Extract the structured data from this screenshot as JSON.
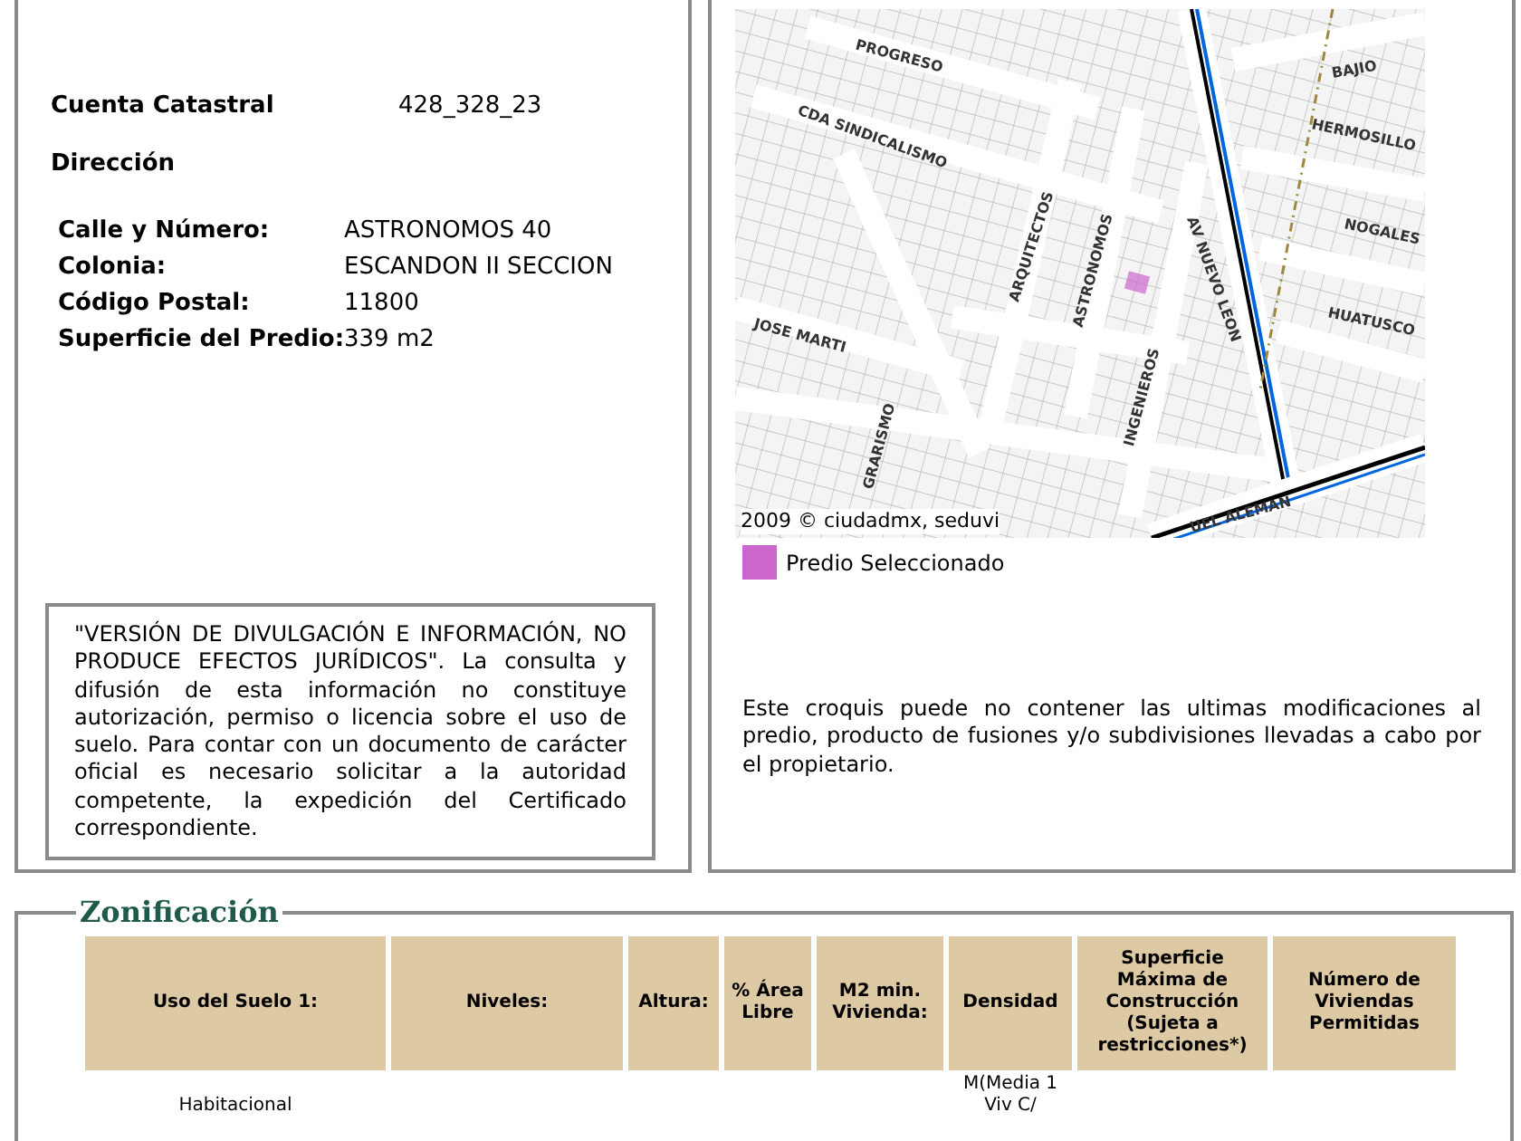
{
  "parcel": {
    "account_label": "Cuenta Catastral",
    "account_value": "428_328_23",
    "address_heading": "Dirección",
    "address": [
      {
        "label": "Calle y Número:",
        "value": "ASTRONOMOS 40"
      },
      {
        "label": "Colonia:",
        "value": "ESCANDON II SECCION"
      },
      {
        "label": "Código Postal:",
        "value": "11800"
      },
      {
        "label": "Superficie del Predio:",
        "value": "339 m2"
      }
    ]
  },
  "disclaimer": "\"VERSIÓN DE DIVULGACIÓN E INFORMACIÓN, NO PRODUCE EFECTOS JURÍDICOS\". La consulta y difusión de esta información no constituye autorización, permiso o licencia sobre el uso de suelo. Para contar con un documento de carácter oficial es necesario solicitar a la autoridad competente, la expedición del Certificado correspondiente.",
  "map": {
    "streets": [
      "PROGRESO",
      "CDA SINDICALISMO",
      "ARQUITECTOS",
      "ASTRONOMOS",
      "AV NUEVO LEON",
      "INGENIEROS",
      "BAJIO",
      "HERMOSILLO",
      "NOGALES",
      "HUATUSCO",
      "JOSE MARTI",
      "GRARISMO",
      "UEL ALEMAN"
    ],
    "credit": "2009 © ciudadmx, seduvi",
    "legend": {
      "label": "Predio Seleccionado",
      "color": "#cc66cc"
    }
  },
  "map_note": "Este croquis puede no contener las ultimas modificaciones al predio, producto de fusiones y/o subdivisiones llevadas a cabo por el propietario.",
  "zoning": {
    "title": "Zonificación",
    "columns": [
      {
        "label": "Uso del Suelo 1:",
        "value": "Habitacional"
      },
      {
        "label": "Niveles:"
      },
      {
        "label": "Altura:"
      },
      {
        "label": "% Área Libre"
      },
      {
        "label": "M2 min. Vivienda:"
      },
      {
        "label": "Densidad",
        "value": "M(Media 1 Viv C/"
      },
      {
        "label": "Superficie Máxima de Construcción (Sujeta a restricciones*)"
      },
      {
        "label": "Número de Viviendas Permitidas"
      }
    ]
  }
}
